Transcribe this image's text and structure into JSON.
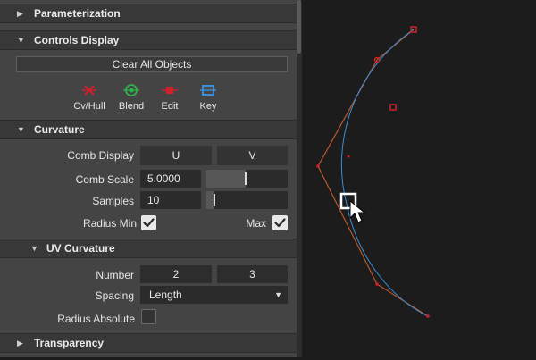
{
  "sections": {
    "parameterization": "Parameterization",
    "controls_display": "Controls Display",
    "curvature": "Curvature",
    "uv_curvature": "UV Curvature",
    "transparency": "Transparency"
  },
  "controls_display": {
    "clear_button": "Clear All Objects",
    "items": [
      {
        "label": "Cv/Hull",
        "icon": "cv-hull-icon",
        "color": "#d0202a"
      },
      {
        "label": "Blend",
        "icon": "blend-icon",
        "color": "#2db34a"
      },
      {
        "label": "Edit",
        "icon": "edit-icon",
        "color": "#d0202a"
      },
      {
        "label": "Key",
        "icon": "key-icon",
        "color": "#3a8fd8"
      }
    ]
  },
  "curvature": {
    "comb_display_label": "Comb Display",
    "comb_display_u": "U",
    "comb_display_v": "V",
    "comb_scale_label": "Comb Scale",
    "comb_scale_value": "5.0000",
    "comb_scale_slider": 0.48,
    "samples_label": "Samples",
    "samples_value": "10",
    "samples_slider": 0.1,
    "radius_min_label": "Radius Min",
    "radius_min_checked": true,
    "max_label": "Max",
    "max_checked": true
  },
  "uv_curvature": {
    "number_label": "Number",
    "number_u": "2",
    "number_v": "3",
    "spacing_label": "Spacing",
    "spacing_value": "Length",
    "radius_absolute_label": "Radius Absolute",
    "radius_absolute_checked": false
  },
  "viewport": {
    "hull_color": "#b8582e",
    "curve_color": "#3a8fd8",
    "cv_color": "#d0202a"
  }
}
